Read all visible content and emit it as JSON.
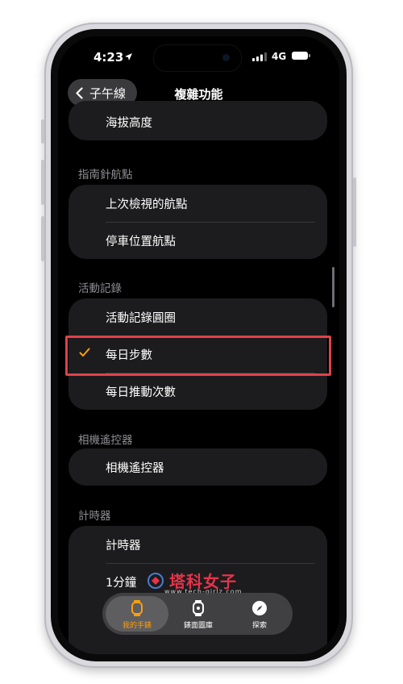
{
  "status": {
    "time": "4:23",
    "network": "4G"
  },
  "nav": {
    "back_label": "子午線",
    "title": "複雜功能"
  },
  "sections": [
    {
      "items": [
        "海拔高度"
      ]
    },
    {
      "header": "指南針航點",
      "items": [
        "上次檢視的航點",
        "停車位置航點"
      ]
    },
    {
      "header": "活動記錄",
      "items": [
        "活動記錄圓圈",
        "每日步數",
        "每日推動次數"
      ],
      "selected": "每日步數"
    },
    {
      "header": "相機遙控器",
      "items": [
        "相機遙控器"
      ]
    },
    {
      "header": "計時器",
      "items": [
        "計時器",
        "1分鐘"
      ]
    }
  ],
  "tabbar": {
    "tabs": [
      "我的手錶",
      "錶面圖庫",
      "探索"
    ],
    "active": "我的手錶"
  },
  "watermark": {
    "title": "塔科女子",
    "url": "www.tech-girlz.com"
  },
  "colors": {
    "accent": "#ff9f0a",
    "highlight_box": "#e0424a",
    "card": "#1c1c1e",
    "header": "#8e8e93"
  }
}
